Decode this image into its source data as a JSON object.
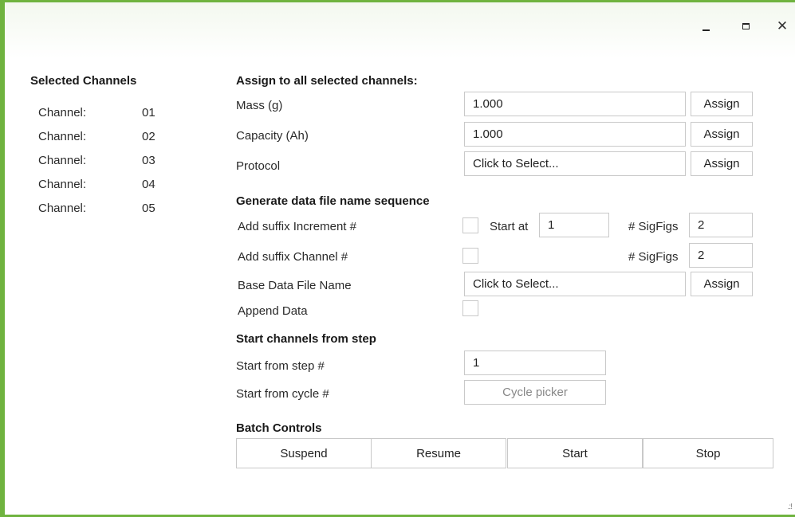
{
  "window": {
    "minimize_icon": "minimize-icon",
    "maximize_icon": "maximize-icon",
    "close_glyph": "✕"
  },
  "left": {
    "title": "Selected Channels",
    "channels": [
      {
        "label": "Channel:",
        "number": "01"
      },
      {
        "label": "Channel:",
        "number": "02"
      },
      {
        "label": "Channel:",
        "number": "03"
      },
      {
        "label": "Channel:",
        "number": "04"
      },
      {
        "label": "Channel:",
        "number": "05"
      }
    ]
  },
  "assign": {
    "title": "Assign to all selected channels:",
    "mass_label": "Mass (g)",
    "mass_value": "1.000",
    "capacity_label": "Capacity (Ah)",
    "capacity_value": "1.000",
    "protocol_label": "Protocol",
    "protocol_value": "Click to Select...",
    "assign_label": "Assign"
  },
  "filename": {
    "title": "Generate data file name sequence",
    "suffix_increment_label": "Add suffix Increment #",
    "start_at_label": "Start at",
    "start_at_value": "1",
    "sigfigs_label": "# SigFigs",
    "sigfigs_increment_value": "2",
    "suffix_channel_label": "Add suffix Channel #",
    "sigfigs_channel_value": "2",
    "base_name_label": "Base Data File Name",
    "base_name_value": "Click to Select...",
    "append_label": "Append Data"
  },
  "step": {
    "title": "Start channels from step",
    "step_label": "Start from step #",
    "step_value": "1",
    "cycle_label": "Start from cycle #",
    "cycle_button": "Cycle picker"
  },
  "batch": {
    "title": "Batch Controls",
    "suspend": "Suspend",
    "resume": "Resume",
    "start": "Start",
    "stop": "Stop"
  },
  "colors": {
    "accent": "#6fb33f"
  }
}
